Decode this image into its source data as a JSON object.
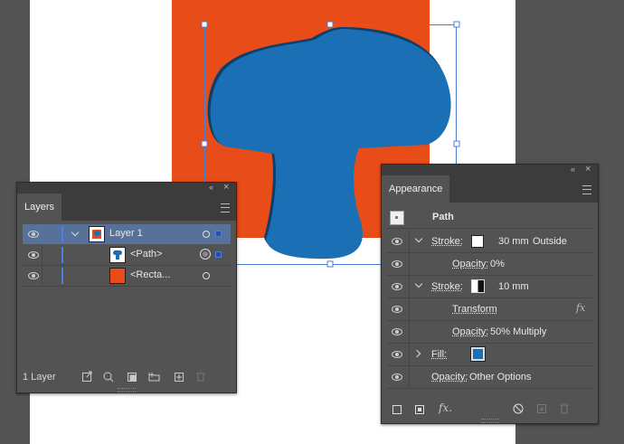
{
  "layers_panel": {
    "tab_label": "Layers",
    "collapse_glyph": "«",
    "close_glyph": "×",
    "rows": [
      {
        "name": "Layer 1"
      },
      {
        "name": "<Path>"
      },
      {
        "name": "<Recta..."
      }
    ],
    "footer_count": "1 Layer"
  },
  "appearance_panel": {
    "tab_label": "Appearance",
    "collapse_glyph": "«",
    "close_glyph": "×",
    "header_label": "Path",
    "rows": [
      {
        "label": "Stroke:",
        "value": "30 mm",
        "extra": "Outside"
      },
      {
        "label": "Opacity:",
        "value": "0%"
      },
      {
        "label": "Stroke:",
        "value": "10 mm"
      },
      {
        "label": "Transform",
        "fx": "fx"
      },
      {
        "label": "Opacity:",
        "value": "50% Multiply"
      },
      {
        "label": "Fill:"
      },
      {
        "label": "Opacity:",
        "value": "Other Options"
      }
    ],
    "footer_fx": "fx."
  },
  "colors": {
    "orange": "#e84c19",
    "blue": "#1a6fb5",
    "selection": "#4d7fd1"
  }
}
